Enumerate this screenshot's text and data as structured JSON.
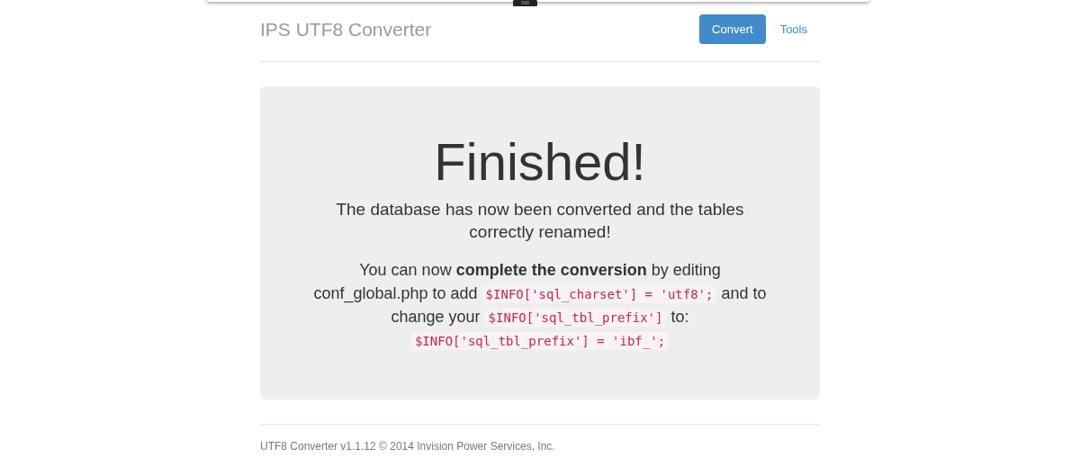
{
  "header": {
    "title": "IPS UTF8 Converter",
    "nav": [
      {
        "label": "Convert",
        "selected": true
      },
      {
        "label": "Tools",
        "selected": false
      }
    ]
  },
  "jumbotron": {
    "heading": "Finished!",
    "lead": "The database has now been converted and the tables correctly renamed!",
    "paragraph": [
      {
        "kind": "text",
        "text": "You can now "
      },
      {
        "kind": "bold",
        "text": "complete the conversion"
      },
      {
        "kind": "text",
        "text": " by editing conf_global.php to add "
      },
      {
        "kind": "code",
        "text": "$INFO['sql_charset'] = 'utf8';"
      },
      {
        "kind": "text",
        "text": " and to change your "
      },
      {
        "kind": "code",
        "text": "$INFO['sql_tbl_prefix']"
      },
      {
        "kind": "text",
        "text": " to: "
      },
      {
        "kind": "code",
        "text": "$INFO['sql_tbl_prefix'] = 'ibf_';"
      }
    ]
  },
  "footer": {
    "text": "UTF8 Converter v1.1.12 © 2014 Invision Power Services, Inc."
  }
}
